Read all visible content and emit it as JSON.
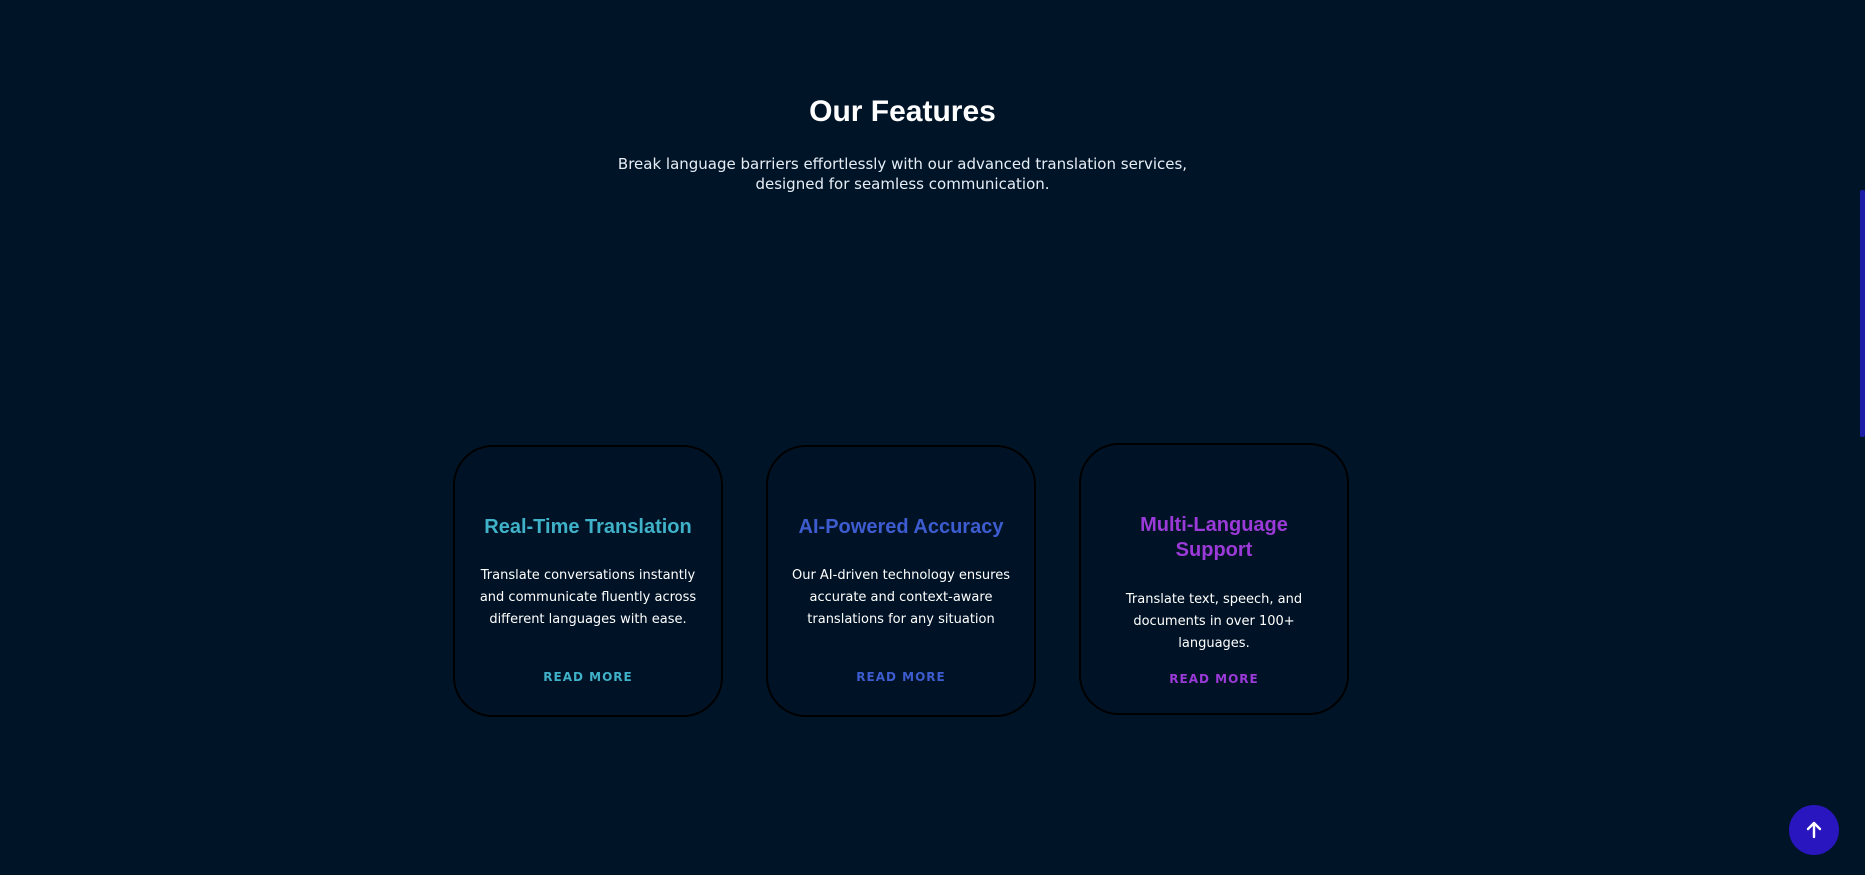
{
  "section": {
    "title": "Our Features",
    "subtitle": "Break language barriers effortlessly with our advanced translation services, designed for seamless communication."
  },
  "cards": [
    {
      "title": "Real-Time Translation",
      "text": "Translate conversations instantly and communicate fluently across different languages with ease.",
      "link": "READ MORE",
      "color": "#3fb1c8"
    },
    {
      "title": "AI-Powered Accuracy",
      "text": "Our AI-driven technology ensures accurate and context-aware translations for any situation",
      "link": "READ MORE",
      "color": "#3d5cd0"
    },
    {
      "title": "Multi-Language Support",
      "text": "Translate text, speech, and documents in over 100+ languages.",
      "link": "READ MORE",
      "color": "#9b3ad8"
    }
  ],
  "scroll_top_button": {
    "icon": "arrow-up-icon",
    "color": "#2a16be"
  },
  "colors": {
    "background": "#001428",
    "heading": "#ffffff"
  }
}
